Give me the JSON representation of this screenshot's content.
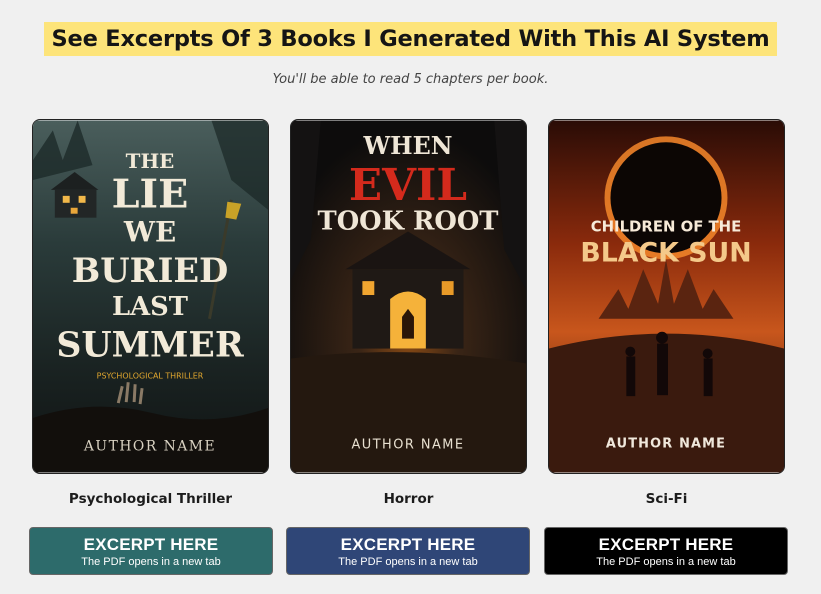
{
  "heading": "See Excerpts Of 3 Books I Generated With This AI System",
  "subtitle": "You'll be able to read 5 chapters per book.",
  "colors": {
    "page_background": "#f0f0f0",
    "heading_highlight": "#fde47a"
  },
  "books": [
    {
      "cover": {
        "title_lines": [
          "THE",
          "LIE",
          "WE",
          "BURIED",
          "LAST",
          "SUMMER"
        ],
        "tagline": "PSYCHOLOGICAL THRILLER",
        "author": "AUTHOR NAME"
      },
      "genre": "Psychological Thriller",
      "button": {
        "label": "EXCERPT HERE",
        "note": "The PDF opens in a new tab",
        "color": "#2d6b6b"
      }
    },
    {
      "cover": {
        "title_lines": [
          "WHEN",
          "EVIL",
          "TOOK ROOT"
        ],
        "author": "AUTHOR NAME"
      },
      "genre": "Horror",
      "button": {
        "label": "EXCERPT HERE",
        "note": "The PDF opens in a new tab",
        "color": "#2f4677"
      }
    },
    {
      "cover": {
        "title_lines": [
          "CHILDREN OF THE",
          "BLACK SUN"
        ],
        "author": "AUTHOR NAME"
      },
      "genre": "Sci-Fi",
      "button": {
        "label": "EXCERPT HERE",
        "note": "The PDF opens in a new tab",
        "color": "#000000"
      }
    }
  ]
}
